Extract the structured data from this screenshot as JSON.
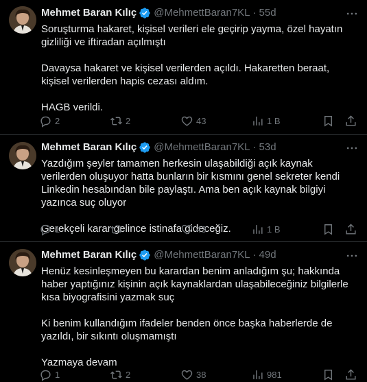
{
  "tweets": [
    {
      "author": "Mehmet Baran Kılıç",
      "handle": "@MehmettBaran7KL",
      "time": "55d",
      "text": "Soruşturma hakaret, kişisel verileri ele geçirip yayma, özel hayatın gizliliği ve iftiradan açılmıştı\n\nDavaysa hakaret ve kişisel verilerden açıldı. Hakaretten beraat, kişisel verilerden hapis cezası aldım.\n\nHAGB verildi.",
      "replies": "2",
      "retweets": "2",
      "likes": "43",
      "views": "1 B"
    },
    {
      "author": "Mehmet Baran Kılıç",
      "handle": "@MehmettBaran7KL",
      "time": "53d",
      "text": "Yazdığım şeyler tamamen herkesin ulaşabildiği açık kaynak verilerden oluşuyor hatta bunların bir kısmını genel sekreter kendi Linkedin hesabından bile paylaştı. Ama ben açık kaynak bilgiyi yazınca suç oluyor\n\nGerekçeli karar gelince istinafa gideceğiz.",
      "replies": "1",
      "retweets": "",
      "likes": "43",
      "views": "1 B"
    },
    {
      "author": "Mehmet Baran Kılıç",
      "handle": "@MehmettBaran7KL",
      "time": "49d",
      "text": "Henüz kesinleşmeyen bu karardan benim anladığım şu; hakkında haber yaptığınız kişinin açık kaynaklardan ulaşabileceğiniz bilgilerle kısa biyografisini yazmak suç\n\nKi benim kullandığım ifadeler benden önce başka haberlerde de yazıldı, bir sıkıntı oluşmamıştı\n\nYazmaya devam",
      "replies": "1",
      "retweets": "2",
      "likes": "38",
      "views": "981"
    }
  ],
  "colors": {
    "background": "#000000",
    "text": "#e7e9ea",
    "muted": "#71767b",
    "verified": "#1d9bf0",
    "divider": "#2f3336"
  },
  "icons": [
    "verified-badge-icon",
    "more-icon",
    "reply-icon",
    "retweet-icon",
    "like-icon",
    "views-icon",
    "bookmark-icon",
    "share-icon"
  ]
}
